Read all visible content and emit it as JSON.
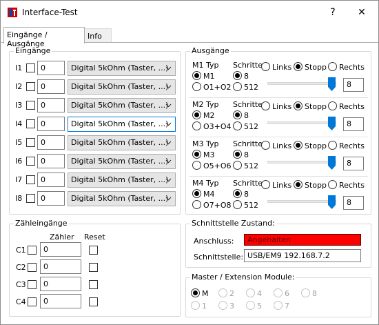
{
  "window": {
    "title": "Interface-Test",
    "help_label": "?",
    "close_label": "✕"
  },
  "tabs": [
    {
      "label": "Eingänge / Ausgänge"
    },
    {
      "label": "Info"
    }
  ],
  "inputs": {
    "title": "Eingänge",
    "rows": [
      {
        "label": "I1",
        "value": "0",
        "mode": "Digital 5kOhm (Taster, ...)"
      },
      {
        "label": "I2",
        "value": "0",
        "mode": "Digital 5kOhm (Taster, ...)"
      },
      {
        "label": "I3",
        "value": "0",
        "mode": "Digital 5kOhm (Taster, ...)"
      },
      {
        "label": "I4",
        "value": "0",
        "mode": "Digital 5kOhm (Taster, ...)"
      },
      {
        "label": "I5",
        "value": "0",
        "mode": "Digital 5kOhm (Taster, ...)"
      },
      {
        "label": "I6",
        "value": "0",
        "mode": "Digital 5kOhm (Taster, ...)"
      },
      {
        "label": "I7",
        "value": "0",
        "mode": "Digital 5kOhm (Taster, ...)"
      },
      {
        "label": "I8",
        "value": "0",
        "mode": "Digital 5kOhm (Taster, ...)"
      }
    ]
  },
  "outputs": {
    "title": "Ausgänge",
    "motors": [
      {
        "type_label": "M1 Typ",
        "steps_label": "Schritte",
        "opt_a": "M1",
        "opt_b": "O1+O2",
        "step_a": "8",
        "step_b": "512",
        "dir_left": "Links",
        "dir_stop": "Stopp",
        "dir_right": "Rechts",
        "speed": "8"
      },
      {
        "type_label": "M2 Typ",
        "steps_label": "Schritte",
        "opt_a": "M2",
        "opt_b": "O3+O4",
        "step_a": "8",
        "step_b": "512",
        "dir_left": "Links",
        "dir_stop": "Stopp",
        "dir_right": "Rechts",
        "speed": "8"
      },
      {
        "type_label": "M3 Typ",
        "steps_label": "Schritte",
        "opt_a": "M3",
        "opt_b": "O5+O6",
        "step_a": "8",
        "step_b": "512",
        "dir_left": "Links",
        "dir_stop": "Stopp",
        "dir_right": "Rechts",
        "speed": "8"
      },
      {
        "type_label": "M4 Typ",
        "steps_label": "Schritte",
        "opt_a": "M4",
        "opt_b": "O7+O8",
        "step_a": "8",
        "step_b": "512",
        "dir_left": "Links",
        "dir_stop": "Stopp",
        "dir_right": "Rechts",
        "speed": "8"
      }
    ]
  },
  "counters": {
    "title": "Zähleingänge",
    "col_count": "Zähler",
    "col_reset": "Reset",
    "rows": [
      {
        "label": "C1",
        "value": "0"
      },
      {
        "label": "C2",
        "value": "0"
      },
      {
        "label": "C3",
        "value": "0"
      },
      {
        "label": "C4",
        "value": "0"
      }
    ]
  },
  "interface": {
    "title": "Schnittstelle Zustand:",
    "connection_label": "Anschluss:",
    "connection_value": "Angehalten",
    "interface_label": "Schnittstelle:",
    "interface_value": "USB/EM9 192.168.7.2"
  },
  "master": {
    "title": "Master / Extension Module:",
    "options_row1": [
      "M",
      "2",
      "4",
      "6",
      "8"
    ],
    "options_row2": [
      "1",
      "3",
      "5",
      "7"
    ]
  },
  "colors": {
    "status_red": "#ff0000",
    "slider_blue": "#0078d7"
  }
}
